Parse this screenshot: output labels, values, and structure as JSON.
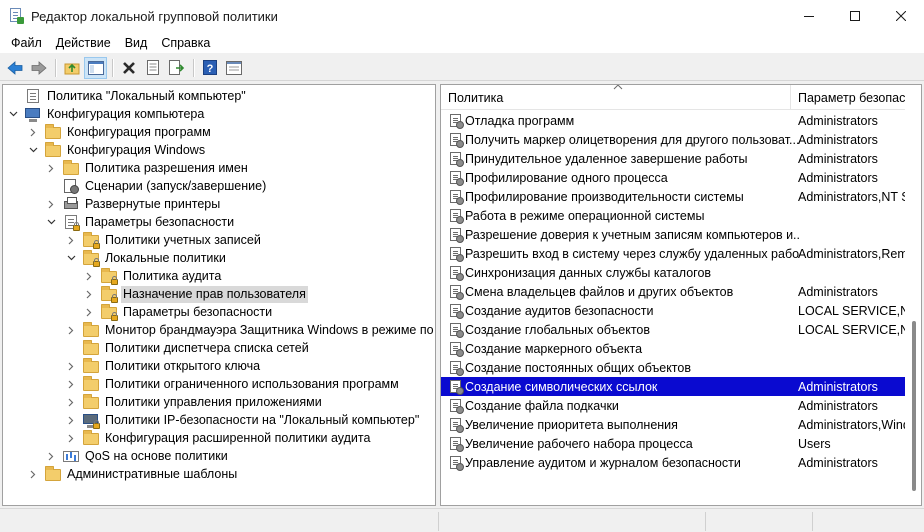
{
  "window": {
    "title": "Редактор локальной групповой политики",
    "minimize_icon": "minimize-icon",
    "maximize_icon": "maximize-icon",
    "close_icon": "close-icon"
  },
  "menu": {
    "items": [
      {
        "label": "Файл"
      },
      {
        "label": "Действие"
      },
      {
        "label": "Вид"
      },
      {
        "label": "Справка"
      }
    ]
  },
  "toolbar": {
    "buttons": [
      "back-arrow-icon",
      "forward-arrow-icon",
      "up-folder-icon",
      "show-hide-tree-icon",
      "delete-icon",
      "properties-icon",
      "export-list-icon",
      "help-icon",
      "console-view-icon"
    ]
  },
  "tree": {
    "items": [
      {
        "label": "Политика \"Локальный компьютер\"",
        "icon": "doc-icon",
        "expander": ""
      },
      {
        "label": "Конфигурация компьютера",
        "icon": "computer-icon",
        "expander": "open"
      },
      {
        "label": "Конфигурация программ",
        "icon": "folder-icon",
        "expander": "closed"
      },
      {
        "label": "Конфигурация Windows",
        "icon": "folder-icon",
        "expander": "open"
      },
      {
        "label": "Политика разрешения имен",
        "icon": "folder-icon",
        "expander": "closed"
      },
      {
        "label": "Сценарии (запуск/завершение)",
        "icon": "script-icon",
        "expander": ""
      },
      {
        "label": "Развернутые принтеры",
        "icon": "printer-icon",
        "expander": "closed"
      },
      {
        "label": "Параметры безопасности",
        "icon": "security-settings-icon",
        "expander": "open"
      },
      {
        "label": "Политики учетных записей",
        "icon": "locked-folder-icon",
        "expander": "closed"
      },
      {
        "label": "Локальные политики",
        "icon": "locked-folder-icon",
        "expander": "open"
      },
      {
        "label": "Политика аудита",
        "icon": "locked-folder-icon",
        "expander": "closed"
      },
      {
        "label": "Назначение прав пользователя",
        "icon": "locked-folder-icon",
        "expander": "closed"
      },
      {
        "label": "Параметры безопасности",
        "icon": "locked-folder-icon",
        "expander": "closed"
      },
      {
        "label": "Монитор брандмауэра Защитника Windows в режиме по",
        "icon": "folder-icon",
        "expander": "closed"
      },
      {
        "label": "Политики диспетчера списка сетей",
        "icon": "folder-icon",
        "expander": ""
      },
      {
        "label": "Политики открытого ключа",
        "icon": "folder-icon",
        "expander": "closed"
      },
      {
        "label": "Политики ограниченного использования программ",
        "icon": "folder-icon",
        "expander": "closed"
      },
      {
        "label": "Политики управления приложениями",
        "icon": "folder-icon",
        "expander": "closed"
      },
      {
        "label": "Политики IP-безопасности на \"Локальный компьютер\"",
        "icon": "ip-security-icon",
        "expander": "closed"
      },
      {
        "label": "Конфигурация расширенной политики аудита",
        "icon": "folder-icon",
        "expander": "closed"
      },
      {
        "label": "QoS на основе политики",
        "icon": "qos-chart-icon",
        "expander": "closed"
      },
      {
        "label": "Административные шаблоны",
        "icon": "folder-icon",
        "expander": "closed"
      }
    ],
    "selected_index": 11
  },
  "list": {
    "columns": {
      "policy": "Политика",
      "setting": "Параметр безопасности"
    },
    "rows": [
      {
        "policy": "Отладка программ",
        "setting": "Administrators"
      },
      {
        "policy": "Получить маркер олицетворения для другого пользоват...",
        "setting": "Administrators"
      },
      {
        "policy": "Принудительное удаленное завершение работы",
        "setting": "Administrators"
      },
      {
        "policy": "Профилирование одного процесса",
        "setting": "Administrators"
      },
      {
        "policy": "Профилирование производительности системы",
        "setting": "Administrators,NT S"
      },
      {
        "policy": "Работа в режиме операционной системы",
        "setting": ""
      },
      {
        "policy": "Разрешение доверия к учетным записям компьютеров и...",
        "setting": ""
      },
      {
        "policy": "Разрешить вход в систему через службу удаленных рабо...",
        "setting": "Administrators,Remo"
      },
      {
        "policy": "Синхронизация данных службы каталогов",
        "setting": ""
      },
      {
        "policy": "Смена владельцев файлов и других объектов",
        "setting": "Administrators"
      },
      {
        "policy": "Создание аудитов безопасности",
        "setting": "LOCAL SERVICE,NET"
      },
      {
        "policy": "Создание глобальных объектов",
        "setting": "LOCAL SERVICE,NET"
      },
      {
        "policy": "Создание маркерного объекта",
        "setting": ""
      },
      {
        "policy": "Создание постоянных общих объектов",
        "setting": ""
      },
      {
        "policy": "Создание символических ссылок",
        "setting": "Administrators"
      },
      {
        "policy": "Создание файла подкачки",
        "setting": "Administrators"
      },
      {
        "policy": "Увеличение приоритета выполнения",
        "setting": "Administrators,Wind"
      },
      {
        "policy": "Увеличение рабочего набора процесса",
        "setting": "Users"
      },
      {
        "policy": "Управление аудитом и журналом безопасности",
        "setting": "Administrators"
      }
    ],
    "selected_index": 14
  },
  "colors": {
    "selection": "#0a0ad0",
    "tree_selection": "#d9d9d9",
    "folder": "#f3cd6b"
  }
}
